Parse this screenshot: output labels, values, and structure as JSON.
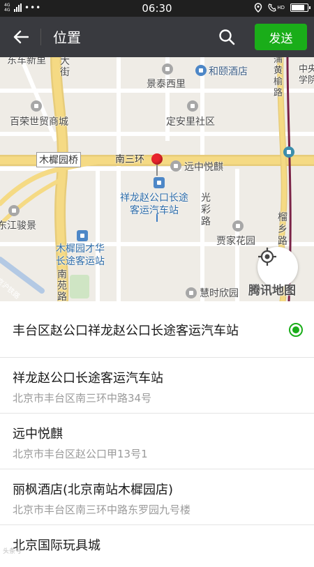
{
  "status_bar": {
    "network": "4G 4G",
    "dots": "•••",
    "time": "06:30",
    "right_badge": "HD",
    "battery_level": 0.85
  },
  "header": {
    "title": "位置",
    "send_label": "发送",
    "back_icon": "arrow-left-icon",
    "search_icon": "search-icon"
  },
  "map": {
    "labels": {
      "dongche": "东车新里",
      "dajie": "大\n街",
      "hexi": "和颐酒店",
      "jingtai": "景泰西里",
      "puhuang": "蒲\n黄\n榆\n路",
      "zhongxue": "中央\n学院",
      "bairong": "百荣世贸商城",
      "dinganli": "定安里社区",
      "muxi_bridge": "木樨园桥",
      "nansanhuan": "南三环",
      "yuanzhong": "远中悦麒",
      "station": "祥龙赵公口长途\n客运汽车站",
      "guangcai": "光\n彩\n路",
      "liuxiang": "榴\n乡\n路",
      "jiangjun": "东江骏景",
      "jiayuan": "贾家花园",
      "muxi_station": "木樨园才华\n长途客运站",
      "nanyuan": "南\n苑\n路",
      "huishi": "慧时欣园",
      "jingpu": "京沪铁路",
      "logo": "腾讯地图"
    },
    "locate_icon": "locate-crosshair-icon"
  },
  "locations": [
    {
      "name": "丰台区赵公口祥龙赵公口长途客运汽车站",
      "address": "",
      "selected": true
    },
    {
      "name": "祥龙赵公口长途客运汽车站",
      "address": "北京市丰台区南三环中路34号",
      "selected": false
    },
    {
      "name": "远中悦麒",
      "address": "北京市丰台区赵公口甲13号1",
      "selected": false
    },
    {
      "name": "丽枫酒店(北京南站木樨园店)",
      "address": "北京市丰台区南三环中路东罗园九号楼",
      "selected": false
    },
    {
      "name": "北京国际玩具城",
      "address": "",
      "selected": false
    }
  ],
  "watermark": "头条号"
}
